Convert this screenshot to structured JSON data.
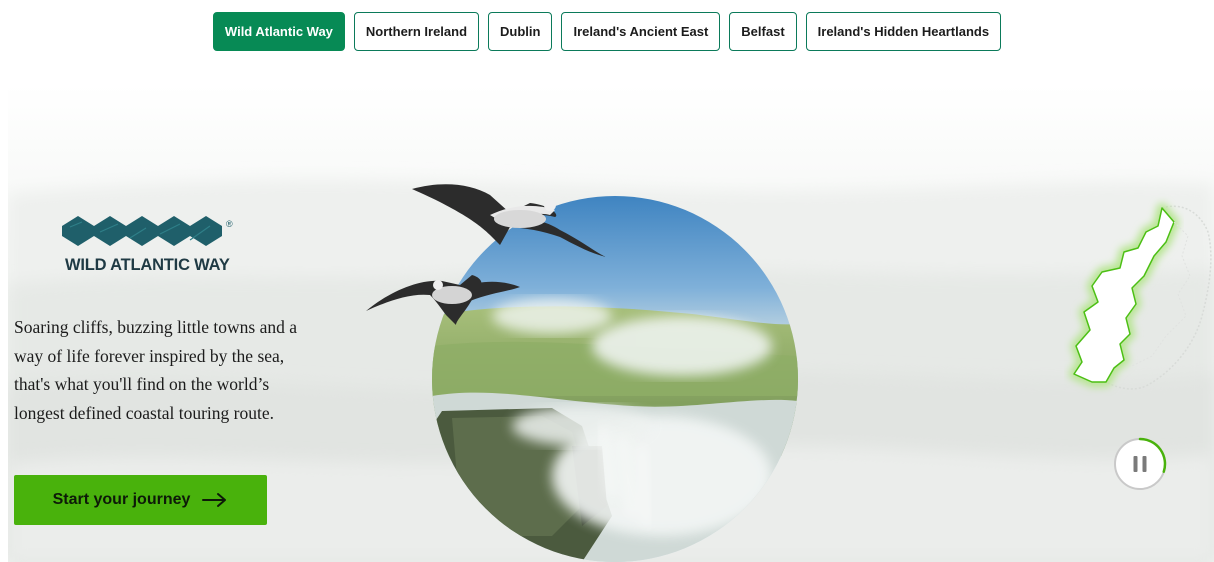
{
  "tabs": [
    {
      "label": "Wild Atlantic Way",
      "active": true
    },
    {
      "label": "Northern Ireland",
      "active": false
    },
    {
      "label": "Dublin",
      "active": false
    },
    {
      "label": "Ireland's Ancient East",
      "active": false
    },
    {
      "label": "Belfast",
      "active": false
    },
    {
      "label": "Ireland's Hidden Heartlands",
      "active": false
    }
  ],
  "brand": {
    "logo_text": "WILD ATLANTIC WAY",
    "registered_mark": "®",
    "colors": {
      "tab_active": "#078a55",
      "tab_border": "#0b7a5a",
      "cta": "#49b20c",
      "logo": "#1f5f6a",
      "map_glow": "#9ee06a"
    }
  },
  "hero": {
    "description": "Soaring cliffs, buzzing little towns and a way of life forever inspired by the sea, that's what you'll find on the world’s longest defined coastal touring route.",
    "cta_label": "Start your journey",
    "cta_icon": "arrow-right-icon"
  },
  "controls": {
    "pause_icon": "pause-icon",
    "progress": 0.3
  }
}
